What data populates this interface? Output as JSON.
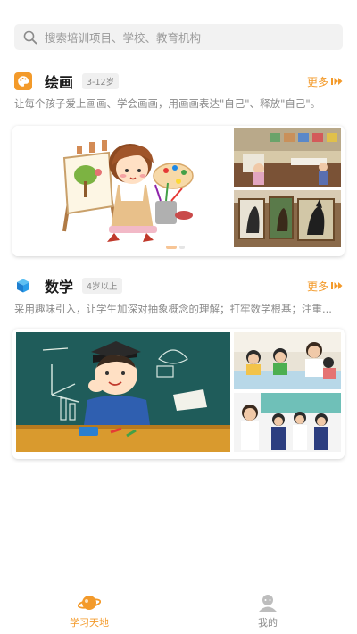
{
  "search": {
    "placeholder": "搜索培训项目、学校、教育机构"
  },
  "sections": [
    {
      "title": "绘画",
      "age": "3-12岁",
      "more": "更多",
      "description": "让每个孩子爱上画画、学会画画，用画画表达\"自己\"、释放\"自己\"。",
      "icon": "palette-icon",
      "accent": "#f39a2a"
    },
    {
      "title": "数学",
      "age": "4岁以上",
      "more": "更多",
      "description": "采用趣味引入，让学生加深对抽象概念的理解；打牢数学根基；注重...",
      "icon": "cube-icon",
      "accent": "#2a8fe0"
    }
  ],
  "tabs": [
    {
      "label": "学习天地",
      "icon": "planet-icon",
      "active": true
    },
    {
      "label": "我的",
      "icon": "user-icon",
      "active": false
    }
  ],
  "colors": {
    "accent": "#f39a2a",
    "inactive": "#8c8c8c"
  },
  "carousel": {
    "count": 2,
    "active": 0
  }
}
